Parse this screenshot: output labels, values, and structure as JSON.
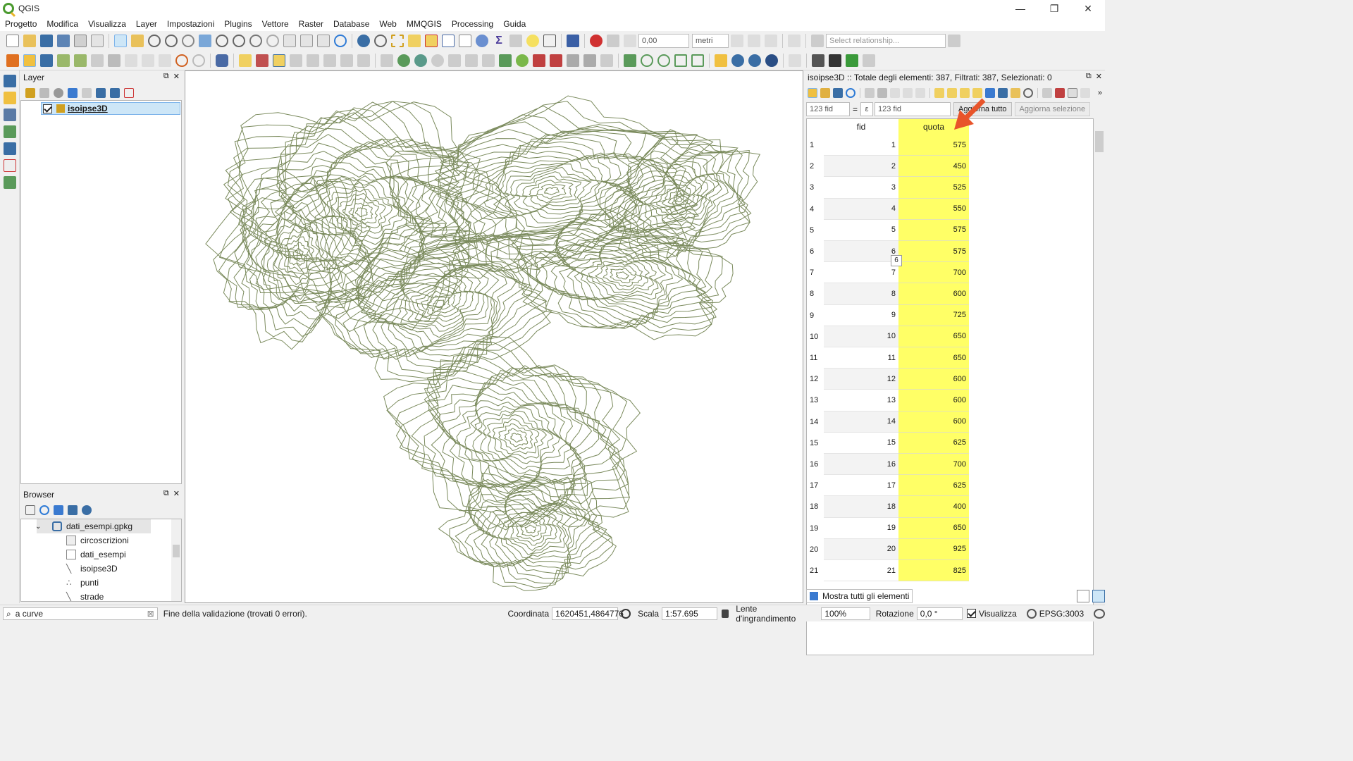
{
  "app": {
    "title": "QGIS"
  },
  "window_controls": {
    "minimize": "—",
    "maximize": "❐",
    "close": "✕"
  },
  "menu": [
    "Progetto",
    "Modifica",
    "Visualizza",
    "Layer",
    "Impostazioni",
    "Plugins",
    "Vettore",
    "Raster",
    "Database",
    "Web",
    "MMQGIS",
    "Processing",
    "Guida"
  ],
  "toolbar": {
    "snap_tolerance": "0,00",
    "units": "metri",
    "relationship_placeholder": "Select relationship..."
  },
  "layers_panel": {
    "title": "Layer",
    "layers": [
      {
        "name": "isoipse3D",
        "checked": true
      }
    ]
  },
  "browser_panel": {
    "title": "Browser",
    "root": "dati_esempi.gpkg",
    "items": [
      "circoscrizioni",
      "dati_esempi",
      "isoipse3D",
      "punti",
      "strade"
    ]
  },
  "attribute_table": {
    "title": "isoipse3D :: Totale degli elementi: 387, Filtrati: 387, Selezionati: 0",
    "field_select": "123 fid",
    "equals": "=",
    "epsilon": "ε",
    "expression_value": "123 fid",
    "update_all": "Aggiorna tutto",
    "update_selection": "Aggiorna selezione",
    "columns": [
      "fid",
      "quota"
    ],
    "rows": [
      {
        "n": "1",
        "fid": "1",
        "quota": "575"
      },
      {
        "n": "2",
        "fid": "2",
        "quota": "450"
      },
      {
        "n": "3",
        "fid": "3",
        "quota": "525"
      },
      {
        "n": "4",
        "fid": "4",
        "quota": "550"
      },
      {
        "n": "5",
        "fid": "5",
        "quota": "575"
      },
      {
        "n": "6",
        "fid": "6",
        "quota": "575"
      },
      {
        "n": "7",
        "fid": "7",
        "quota": "700"
      },
      {
        "n": "8",
        "fid": "8",
        "quota": "600"
      },
      {
        "n": "9",
        "fid": "9",
        "quota": "725"
      },
      {
        "n": "10",
        "fid": "10",
        "quota": "650"
      },
      {
        "n": "11",
        "fid": "11",
        "quota": "650"
      },
      {
        "n": "12",
        "fid": "12",
        "quota": "600"
      },
      {
        "n": "13",
        "fid": "13",
        "quota": "600"
      },
      {
        "n": "14",
        "fid": "14",
        "quota": "600"
      },
      {
        "n": "15",
        "fid": "15",
        "quota": "625"
      },
      {
        "n": "16",
        "fid": "16",
        "quota": "700"
      },
      {
        "n": "17",
        "fid": "17",
        "quota": "625"
      },
      {
        "n": "18",
        "fid": "18",
        "quota": "400"
      },
      {
        "n": "19",
        "fid": "19",
        "quota": "650"
      },
      {
        "n": "20",
        "fid": "20",
        "quota": "925"
      },
      {
        "n": "21",
        "fid": "21",
        "quota": "825"
      }
    ],
    "tooltip": "6",
    "show_all": "Mostra tutti gli elementi",
    "highlight_color": "#ffff66",
    "arrow_color": "#e8542a"
  },
  "status_bar": {
    "locator_text": "a curve",
    "message": "Fine della validazione (trovati 0 errori).",
    "coord_label": "Coordinata",
    "coord_value": "1620451,4864776",
    "scale_label": "Scala",
    "scale_value": "1:57.695",
    "magnifier_label": "Lente d'ingrandimento",
    "magnifier_value": "100%",
    "rotation_label": "Rotazione",
    "rotation_value": "0,0 °",
    "render_label": "Visualizza",
    "crs": "EPSG:3003"
  },
  "map": {
    "contour_color": "#7a8a5c"
  }
}
